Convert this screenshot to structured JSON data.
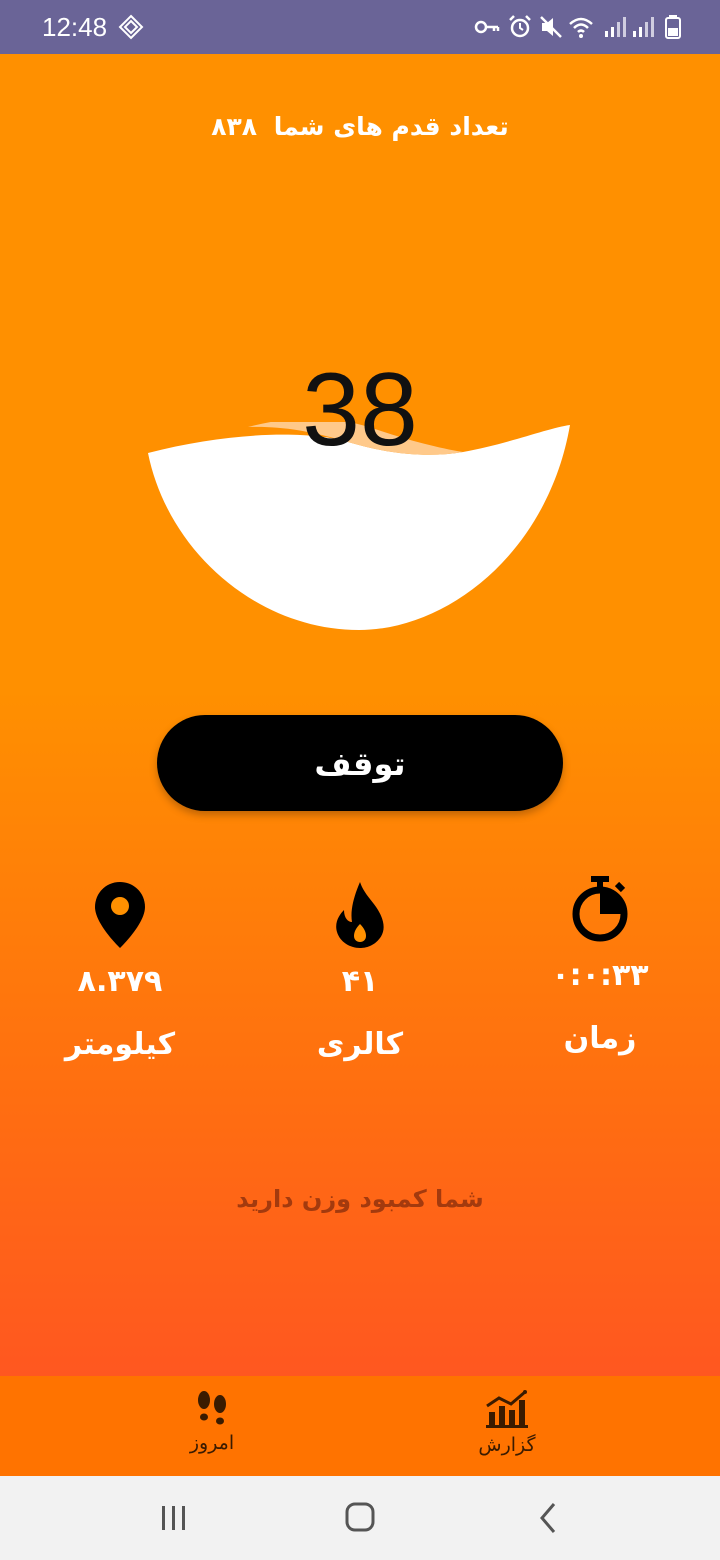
{
  "status_bar": {
    "time": "12:48",
    "icons": [
      "location-diamond-icon",
      "key-icon",
      "alarm-icon",
      "mute-icon",
      "wifi-icon",
      "signal-icon",
      "signal-icon",
      "battery-icon"
    ]
  },
  "header": {
    "title": "تعداد قدم های شما",
    "total_steps": "۸۳۸"
  },
  "gauge": {
    "value": "38",
    "fill_color": "#ffffff",
    "wave_color": "#ffc98a"
  },
  "controls": {
    "stop_label": "توقف"
  },
  "stats": {
    "distance": {
      "icon": "map-pin-icon",
      "value": "۸.۳۷۹",
      "label": "کیلومتر"
    },
    "calories": {
      "icon": "flame-icon",
      "value": "۴۱",
      "label": "کالری"
    },
    "time": {
      "icon": "stopwatch-icon",
      "value": "۰:۰:۳۳",
      "label": "زمان"
    }
  },
  "message": {
    "text": "شما کمبود وزن دارید"
  },
  "bottom_nav": {
    "today": {
      "icon": "footsteps-icon",
      "label": "امروز"
    },
    "report": {
      "icon": "bar-chart-icon",
      "label": "گزارش"
    }
  },
  "colors": {
    "primary": "#ff9000",
    "status_bar": "#6a6497",
    "bottom_nav": "#ff7300",
    "button": "#000000"
  }
}
